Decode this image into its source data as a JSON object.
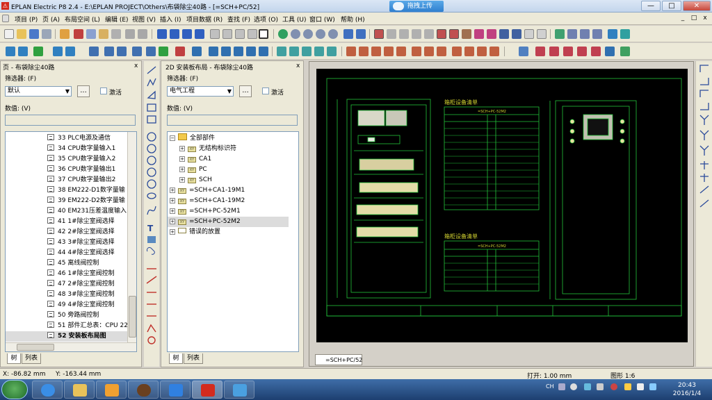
{
  "window": {
    "title": "EPLAN Electric P8 2.4 - E:\\EPLAN PROJECT\\Others\\布袋除尘40路 - [=SCH+PC/52]",
    "upload_button": "拖拽上传",
    "minimize": "—",
    "maximize": "□",
    "close": "✕"
  },
  "menu": {
    "items": [
      "项目 (P)",
      "页 (A)",
      "布局空间 (L)",
      "编辑 (E)",
      "视图 (V)",
      "插入 (I)",
      "项目数据 (R)",
      "查找 (F)",
      "选项 (O)",
      "工具 (U)",
      "窗口 (W)",
      "帮助 (H)"
    ],
    "mdi_min": "_",
    "mdi_max": "□",
    "mdi_close": "x"
  },
  "page_panel": {
    "title": "页 - 布袋除尘40路",
    "close": "x",
    "filter_label": "筛选器: (F)",
    "filter_value": "默认",
    "browse": "...",
    "activate_label": "激活",
    "value_label": "数值: (V)",
    "pages": [
      "33 PLC电源及通信",
      "34 CPU数字量输入1",
      "35 CPU数字量输入2",
      "36 CPU数字量输出1",
      "37 CPU数字量输出2",
      "38 EM222-D1数字量输",
      "39 EM222-D2数字量输",
      "40 EM231压差温度输入",
      "41 1#除尘室阀选择",
      "42 2#除尘室阀选择",
      "43 3#除尘室阀选择",
      "44 4#除尘室阀选择",
      "45 离线阀控制",
      "46 1#除尘室阀控制",
      "47 2#除尘室阀控制",
      "48 3#除尘室阀控制",
      "49 4#除尘室阀控制",
      "50 旁路阀控制",
      "51 部件汇总表：CPU 22",
      "52 安装板布局图"
    ],
    "selected_index": 19,
    "tab_tree": "树",
    "tab_list": "列表"
  },
  "layout_panel": {
    "title": "2D 安装板布局 - 布袋除尘40路",
    "close": "x",
    "filter_label": "筛选器: (F)",
    "filter_value": "电气工程",
    "browse": "...",
    "activate_label": "激活",
    "value_label": "数值: (V)",
    "tree": {
      "root": "全部部件",
      "root_children": [
        "无结构标识符",
        "CA1",
        "PC",
        "SCH"
      ],
      "items": [
        "=SCH+CA1-19M1",
        "=SCH+CA1-19M2",
        "=SCH+PC-52M1",
        "=SCH+PC-52M2",
        "错误的放置"
      ],
      "selected_item": "=SCH+PC-52M2"
    },
    "tab_tree": "树",
    "tab_list": "列表"
  },
  "drawing": {
    "doc_tab": "=SCH+PC/52",
    "table1_title": "箱柜设备清单",
    "table1_header": "=SCH+PC-52M2",
    "table2_title": "箱柜设备清单",
    "table2_header": "=SCH+PC-52M2",
    "line_color": "#22c43a",
    "text_color": "#d4d431"
  },
  "status": {
    "x": "X: -86.82 mm",
    "y": "Y: -163.44 mm",
    "open": "打开: 1.00 mm",
    "grid": "图形 1:6"
  },
  "taskbar": {
    "lang": "CH",
    "time": "20:43",
    "date": "2016/1/4"
  }
}
